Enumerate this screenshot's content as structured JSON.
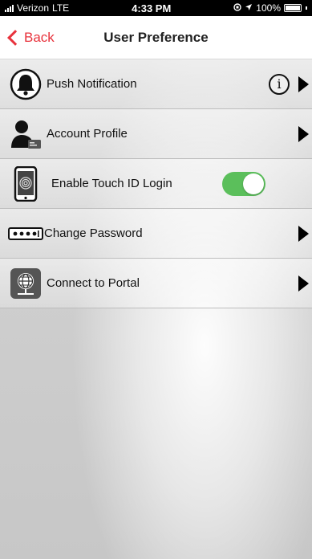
{
  "status_bar": {
    "carrier": "Verizon",
    "network": "LTE",
    "time": "4:33 PM",
    "battery": "100%"
  },
  "nav": {
    "back_label": "Back",
    "title": "User Preference"
  },
  "rows": [
    {
      "label": "Push Notification",
      "icon": "bell-icon",
      "has_info": true,
      "has_arrow": true
    },
    {
      "label": "Account Profile",
      "icon": "person-icon",
      "has_arrow": true
    },
    {
      "label": "Enable Touch ID Login",
      "icon": "fingerprint-phone-icon",
      "toggle_on": true
    },
    {
      "label": "Change Password",
      "icon": "password-icon",
      "has_arrow": true
    },
    {
      "label": "Connect to Portal",
      "icon": "globe-portal-icon",
      "has_arrow": true
    }
  ],
  "colors": {
    "accent": "#e8323c",
    "toggle_on": "#5bbf5b"
  }
}
